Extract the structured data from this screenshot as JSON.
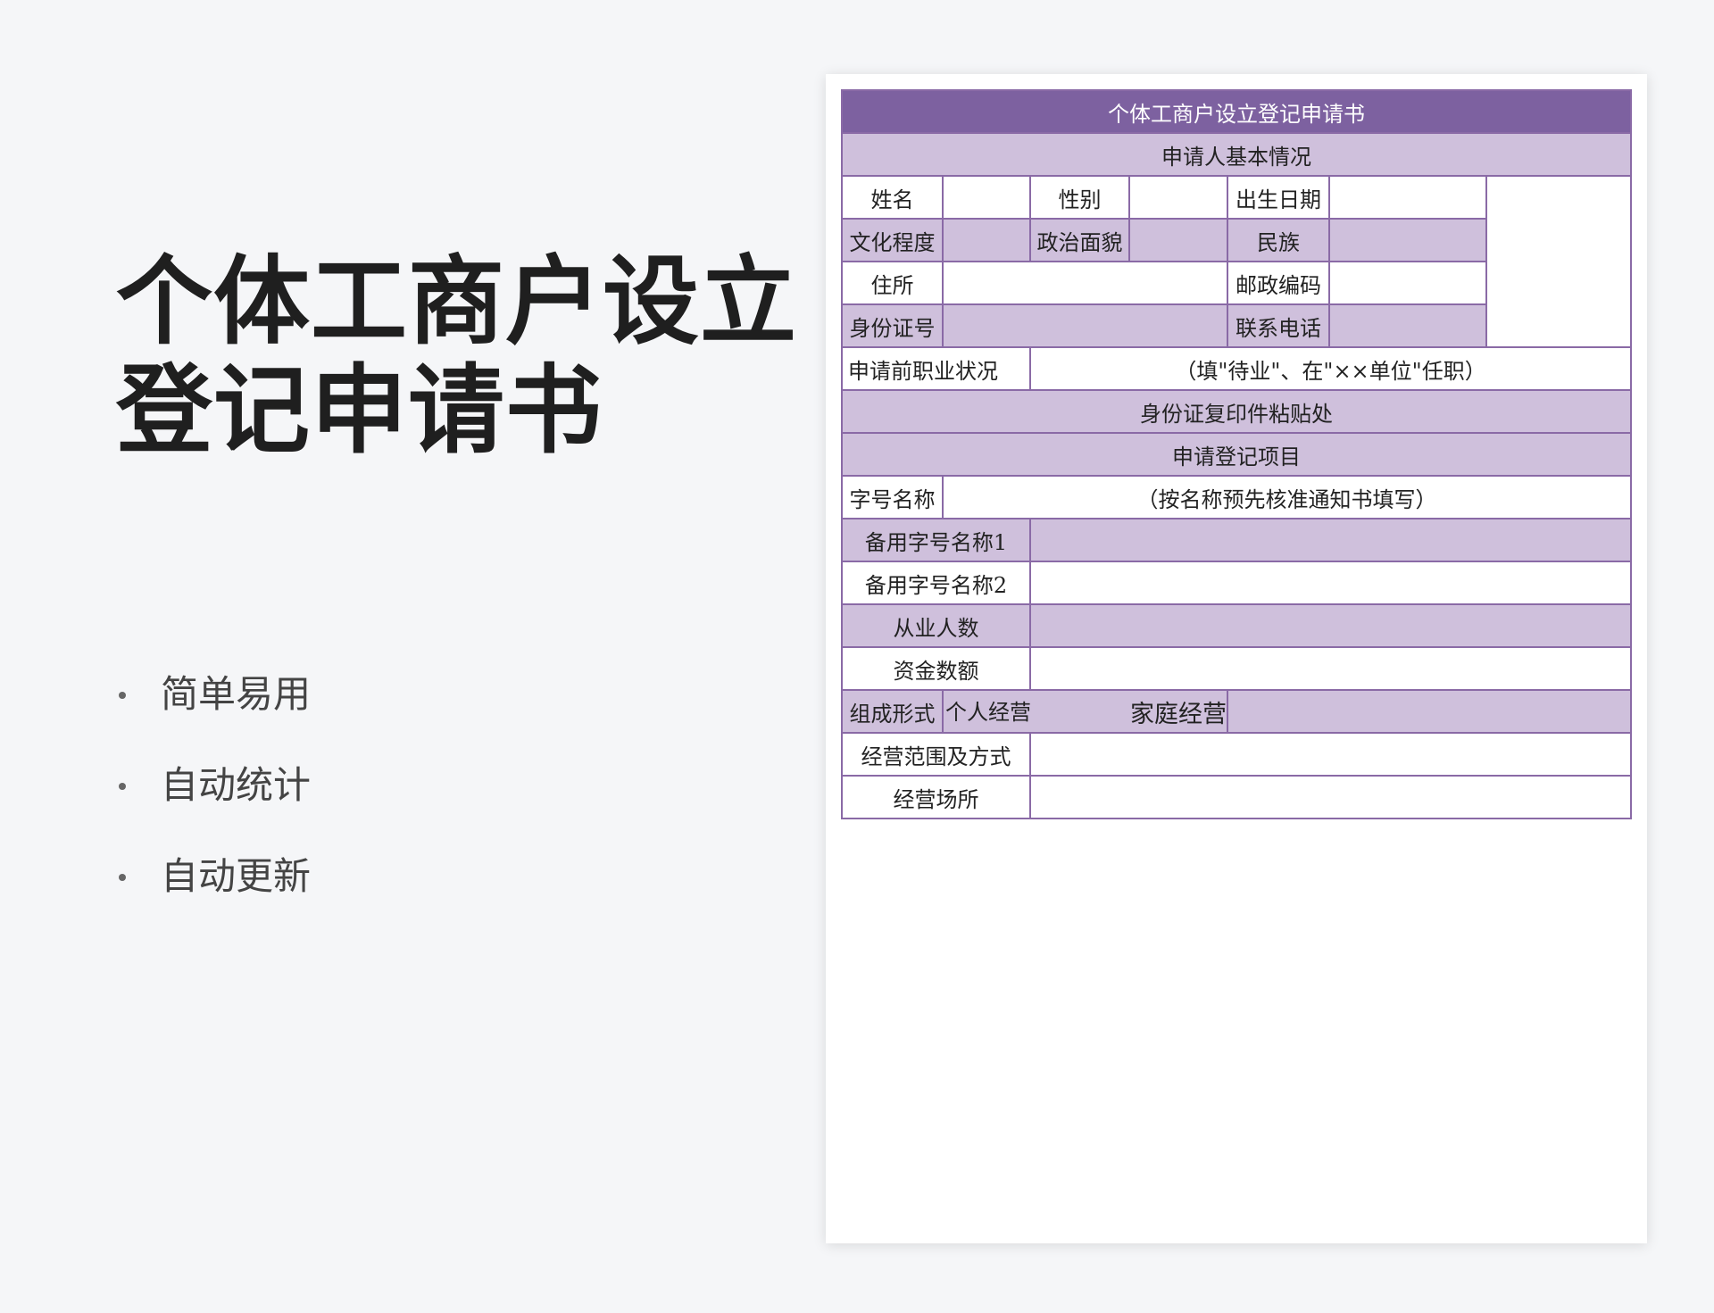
{
  "hero": {
    "title_line1": "个体工商户设立",
    "title_line2": "登记申请书"
  },
  "features": [
    "简单易用",
    "自动统计",
    "自动更新"
  ],
  "form": {
    "title": "个体工商户设立登记申请书",
    "section1": "申请人基本情况",
    "row_name": {
      "c1": "姓名",
      "c2": "性别",
      "c3": "出生日期"
    },
    "row_edu": {
      "c1": "文化程度",
      "c2": "政治面貌",
      "c3": "民族"
    },
    "row_addr": {
      "c1": "住所",
      "c2": "邮政编码"
    },
    "row_id": {
      "c1": "身份证号",
      "c2": "联系电话"
    },
    "row_job": {
      "label": "申请前职业状况",
      "note": "（填\"待业\"、在\"××单位\"任职）"
    },
    "photo": "身份证复印件粘贴处",
    "section2": "申请登记项目",
    "trade_name": {
      "label": "字号名称",
      "note": "（按名称预先核准通知书填写）"
    },
    "alt1": "备用字号名称1",
    "alt2": "备用字号名称2",
    "employees": "从业人数",
    "capital": "资金数额",
    "composition": {
      "label": "组成形式",
      "opt1": "个人经营",
      "opt2": "家庭经营"
    },
    "scope": "经营范围及方式",
    "place": "经营场所"
  }
}
